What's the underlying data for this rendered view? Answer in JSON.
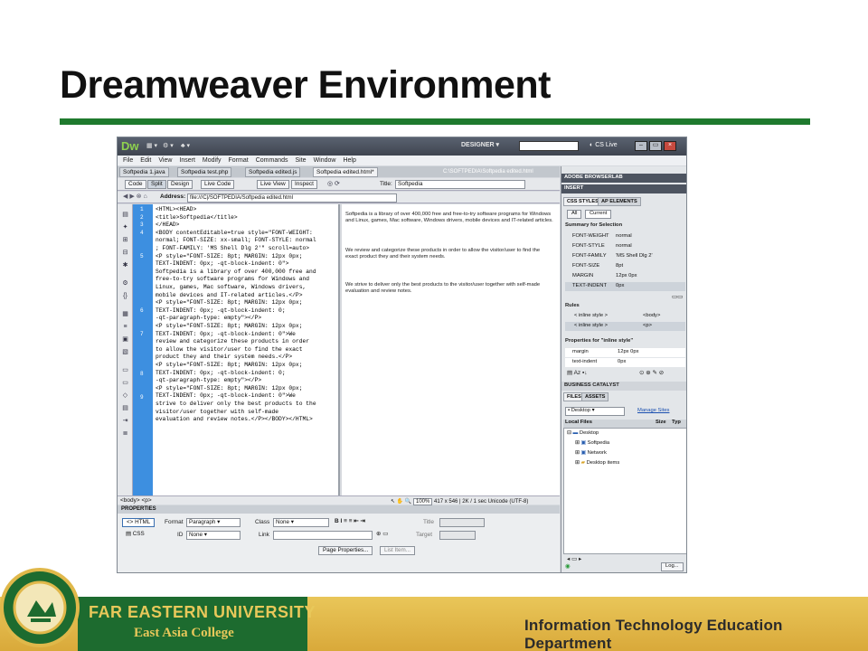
{
  "slide": {
    "title": "Dreamweaver Environment",
    "colors": {
      "title_rule": "#1f7a2e",
      "footer_gold": "#e0b84a",
      "footer_green": "#1d6b2f"
    }
  },
  "app": {
    "logo": "Dw",
    "workspace": "DESIGNER",
    "cs_live": "CS Live",
    "menu": [
      "File",
      "Edit",
      "View",
      "Insert",
      "Modify",
      "Format",
      "Commands",
      "Site",
      "Window",
      "Help"
    ],
    "doc_tabs": [
      "Softpedia 1.java",
      "Softpedia test.php",
      "Softpedia edited.js",
      "Softpedia edited.html*"
    ],
    "doc_path": "C:\\SOFTPEDIA\\Softpedia edited.html",
    "view_buttons": [
      "Code",
      "Split",
      "Design",
      "Live Code",
      "Live View",
      "Inspect"
    ],
    "title_label": "Title:",
    "title_value": "Softpedia",
    "address_label": "Address:",
    "address_value": "file:///C|/SOFTPEDIA/Softpedia edited.html"
  },
  "code": {
    "line_numbers": [
      "1",
      "2",
      "3",
      "4",
      "5",
      "6",
      "7",
      "8",
      "9"
    ],
    "lines": [
      "<HTML><HEAD>",
      "<title>Softpedia</title>",
      "</HEAD>",
      "<BODY contentEditable=true style=\"FONT-WEIGHT:",
      "normal; FONT-SIZE: xx-small; FONT-STYLE: normal",
      "; FONT-FAMILY: 'MS Shell Dlg 2'\" scroll=auto>",
      "<P style=\"FONT-SIZE: 8pt; MARGIN: 12px 0px;",
      "TEXT-INDENT: 0px; -qt-block-indent: 0\">",
      "Softpedia is a library of over 400,000 free and",
      " free-to-try software programs for Windows and",
      "Linux, games, Mac software, Windows drivers,",
      "mobile devices and IT-related articles.</P>",
      "<P style=\"FONT-SIZE: 8pt; MARGIN: 12px 0px;",
      "TEXT-INDENT: 0px; -qt-block-indent: 0;",
      "-qt-paragraph-type: empty\"></P>",
      "<P style=\"FONT-SIZE: 8pt; MARGIN: 12px 0px;",
      "TEXT-INDENT: 0px; -qt-block-indent: 0\">We",
      "review and categorize these products in order",
      "to allow the visitor/user to find the exact",
      "product they and their system needs.</P>",
      "<P style=\"FONT-SIZE: 8pt; MARGIN: 12px 0px;",
      "TEXT-INDENT: 0px; -qt-block-indent: 0;",
      "-qt-paragraph-type: empty\"></P>",
      "<P style=\"FONT-SIZE: 8pt; MARGIN: 12px 0px;",
      "TEXT-INDENT: 0px; -qt-block-indent: 0\">We",
      "strive to deliver only the best products to the",
      " visitor/user together with self-made",
      "evaluation and review notes.</P></BODY></HTML>"
    ]
  },
  "design": {
    "paragraphs": [
      "Softpedia is a library of over 400,000 free and free-to-try software programs for Windows and Linux, games, Mac software, Windows drivers, mobile devices and IT-related articles.",
      "We review and categorize these products in order to allow the visitor/user to find the exact product they and their system needs.",
      "We strive to deliver only the best products to the visitor/user together with self-made evaluation and review notes."
    ]
  },
  "status": {
    "tags": "<body> <p>",
    "zoom": "100%",
    "size": "417 x 546",
    "weight": "2K / 1 sec",
    "encoding": "Unicode (UTF-8)"
  },
  "properties": {
    "header": "PROPERTIES",
    "html_btn": "HTML",
    "css_btn": "CSS",
    "format_label": "Format",
    "format_value": "Paragraph",
    "class_label": "Class",
    "class_value": "None",
    "id_label": "ID",
    "id_value": "None",
    "link_label": "Link",
    "title_label": "Title",
    "target_label": "Target",
    "page_props_btn": "Page Properties...",
    "list_item_btn": "List Item..."
  },
  "panels": {
    "browserlab": "ADOBE BROWSERLAB",
    "insert": "INSERT",
    "css_styles_tab": "CSS STYLES",
    "ap_elements_tab": "AP ELEMENTS",
    "all_btn": "All",
    "current_btn": "Current",
    "summary_title": "Summary for Selection",
    "summary": [
      {
        "k": "FONT-WEIGHT",
        "v": "normal"
      },
      {
        "k": "FONT-STYLE",
        "v": "normal"
      },
      {
        "k": "FONT-FAMILY",
        "v": "'MS Shell Dlg 2'"
      },
      {
        "k": "FONT-SIZE",
        "v": "8pt"
      },
      {
        "k": "MARGIN",
        "v": "12px 0px"
      },
      {
        "k": "TEXT-INDENT",
        "v": "0px"
      }
    ],
    "rules_title": "Rules",
    "rules": [
      {
        "k": "< inline style >",
        "v": "<body>"
      },
      {
        "k": "< inline style >",
        "v": "<p>"
      }
    ],
    "props_title": "Properties for \"inline style\"",
    "props": [
      {
        "k": "margin",
        "v": "12px 0px"
      },
      {
        "k": "text-indent",
        "v": "0px"
      }
    ],
    "business_catalyst": "BUSINESS CATALYST",
    "files_tab": "FILES",
    "assets_tab": "ASSETS",
    "site_select": "Desktop",
    "manage_sites": "Manage Sites",
    "local_files": "Local Files",
    "size_col": "Size",
    "type_col": "Typ",
    "tree": [
      "Desktop",
      "Softpedia",
      "Network",
      "Desktop items"
    ],
    "log_btn": "Log..."
  },
  "footer": {
    "university": "FAR EASTERN UNIVERSITY",
    "college": "East Asia College",
    "department": "Information Technology Education Department"
  }
}
